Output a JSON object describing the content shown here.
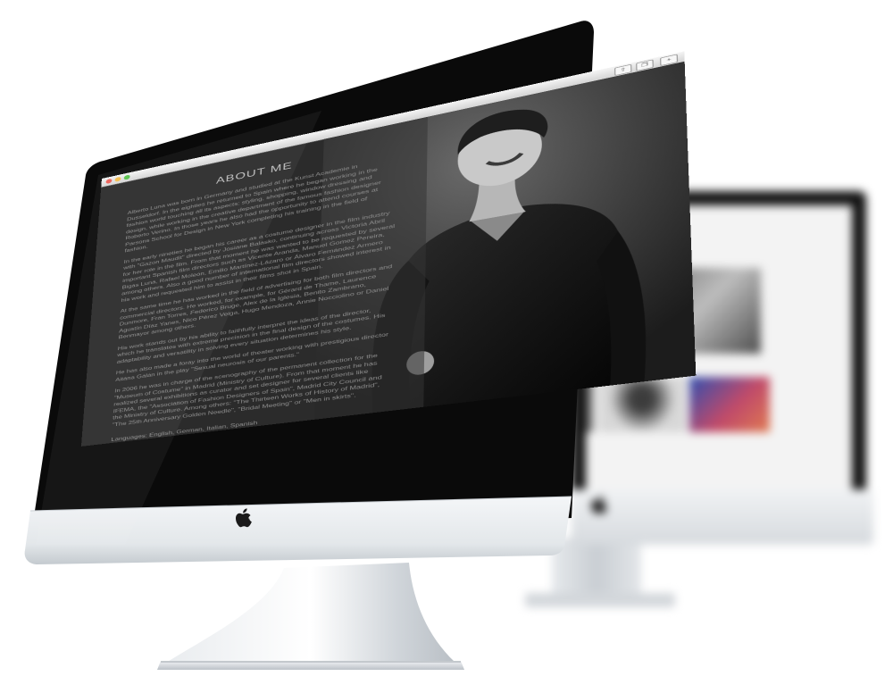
{
  "browser": {
    "window_controls": [
      "close",
      "minimize",
      "zoom"
    ],
    "toolbar_icons": [
      "share-icon",
      "tabs-icon",
      "add-tab-icon"
    ],
    "add_tab_label": "+"
  },
  "about": {
    "title": "ABOUT ME",
    "paragraphs": [
      "Alberto Luna was born in Germany and studied at the Kunst Academie in Dusseldorf. In the eighties he returned to Spain where he began working in the fashion world touching all its aspects: styling, shopping, window dressing and design, while working in the creative department of the famous fashion designer Roberto Verino. In those years he also had the opportunity to attend courses at Parsons School for Design in New York completing his training in the field of fashion.",
      "In the early nineties he began his career as a costume designer in the film industry with \"Gazon Maudit\" directed by Josiane Balasko, continuing across Victoria Abril for her role in the film. From that moment he was wanted to be requested by several important Spanish film directors such as Vicente Aranda, Manuel Gomez Pereira, Bigas Luna, Rafael Moleón, Emilio Martínez-Lázaro or Álvaro Fernández Armero among others. Also a good number of international film directors showed interest in his work and requested him to assist in their films shot in Spain.",
      "At the same time he has worked in the field of advertising for both film directors and commercial directors. He worked, for example, for Gérard de Thame, Laurence Dunmore, Fran Torres, Federico Bruge, Alex de la Iglesia, Benito Zambrano, Agustín Díaz Yanes, Nico Pérez Veiga, Hugo Mendoza, Annie Nocciolino or Daniel Benmayor among others.",
      "His work stands out by his ability to faithfully interpret the ideas of the director, which he translates with extreme precision in the final design of the costumes. His adaptability and versatility in solving every situation determines his style.",
      "He has also made a foray into the world of theater working with prestigious director Aitana Galán in the play \"Sexual neurosis of our parents.\"",
      "In 2006 he was in charge of the scenography of the permanent collection for the \"Museum of Costume\" in Madrid (Ministry of Culture). From that moment he has realized several exhibitions as curator and set designer for several clients like IFEMA, the \"Association of Fashion Designers of Spain\", Madrid City Council and the Ministry of Culture. Among others: \"The Thirteen Works of History of Madrid\", \"The 25th Anniversary Golden Needle\", \"Bridal Meeting\" or \"Men in skirts\"."
    ],
    "languages": "Languages: English, German, Italian, Spanish"
  },
  "icons": {
    "front_logo": "apple-logo-icon",
    "back_logo": "apple-logo-icon"
  }
}
